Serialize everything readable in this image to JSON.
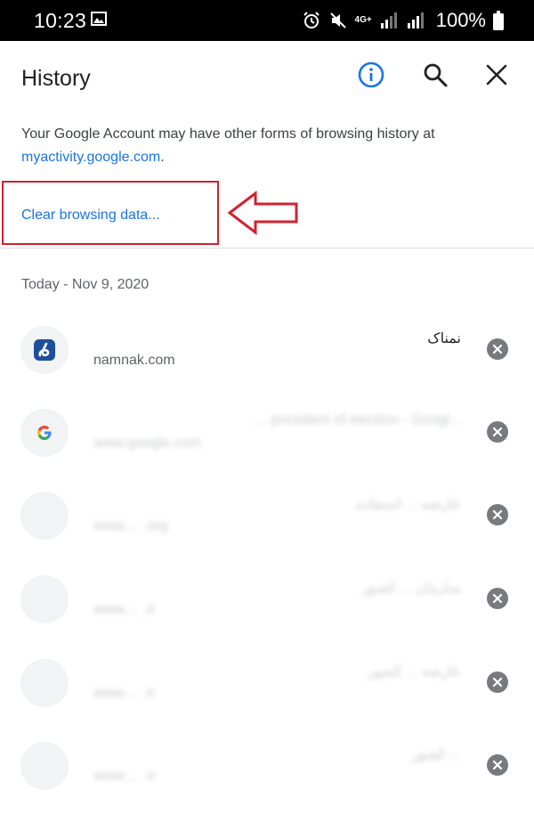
{
  "status_bar": {
    "time": "10:23",
    "network": "4G+",
    "battery": "100%"
  },
  "header": {
    "title": "History",
    "icons": [
      "info-icon",
      "search-icon",
      "close-icon"
    ]
  },
  "account_note": {
    "text": "Your Google Account may have other forms of browsing history at ",
    "link": "myactivity.google.com",
    "end": "."
  },
  "clear_browsing": {
    "label": "Clear browsing data..."
  },
  "date_header": "Today - Nov 9, 2020",
  "colors": {
    "accent": "#1a73e8",
    "highlight": "#d4202f"
  },
  "history": [
    {
      "title": "نمناک",
      "url": "namnak.com"
    },
    {
      "title": "... president of election - Googl...",
      "url": "www.google.com"
    },
    {
      "title": "عارضه ... استفاده",
      "url": "www.... .org"
    },
    {
      "title": "سازمان ... کشور",
      "url": "www.... .ir"
    },
    {
      "title": "عارضه ... کشور",
      "url": "www.... .ir"
    },
    {
      "title": "... کشور",
      "url": "www.... .ir"
    }
  ]
}
